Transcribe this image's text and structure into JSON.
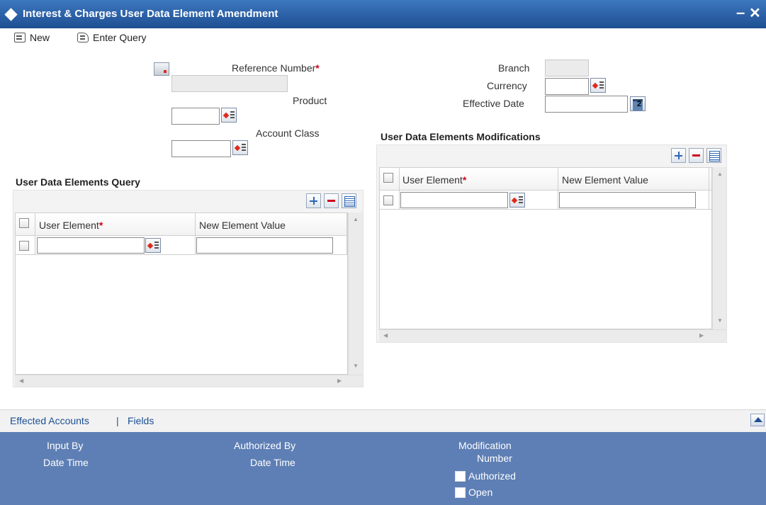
{
  "window": {
    "title": "Interest & Charges User Data Element Amendment",
    "minimize_glyph": "–",
    "close_glyph": "✕"
  },
  "toolbar": {
    "new_label": "New",
    "enter_query_label": "Enter Query"
  },
  "form": {
    "reference_number_label": "Reference Number",
    "required_mark": "*",
    "product_label": "Product",
    "account_class_label": "Account Class",
    "branch_label": "Branch",
    "currency_label": "Currency",
    "effective_date_label": "Effective Date",
    "reference_number_value": "",
    "branch_value": "",
    "currency_value": "",
    "effective_date_value": "",
    "product_value": "",
    "account_class_value": ""
  },
  "query_grid": {
    "title": "User Data Elements Query",
    "columns": [
      "User Element",
      "New Element Value"
    ],
    "rows": [
      {
        "user_element": "",
        "new_element_value": ""
      }
    ]
  },
  "mod_grid": {
    "title": "User Data Elements Modifications",
    "columns": [
      "User Element",
      "New Element Value"
    ],
    "rows": [
      {
        "user_element": "",
        "new_element_value": ""
      }
    ]
  },
  "footer_links": {
    "effected_accounts": "Effected Accounts",
    "separator": "|",
    "fields": "Fields"
  },
  "audit": {
    "input_by": "Input By",
    "date_time": "Date Time",
    "authorized_by": "Authorized By",
    "date_time_2": "Date Time",
    "modification_number_line1": "Modification",
    "modification_number_line2": "Number",
    "authorized": "Authorized",
    "open": "Open"
  },
  "icons": {
    "diamond": "diamond-icon",
    "lov": "list-of-values-icon",
    "calendar": "calendar-icon",
    "add": "plus-icon",
    "delete": "minus-icon",
    "single_view": "list-view-icon"
  },
  "colors": {
    "title_bar": "#2a5ea4",
    "audit_panel": "#5e7fb5",
    "link": "#1b4f93",
    "required": "#d0021b"
  }
}
